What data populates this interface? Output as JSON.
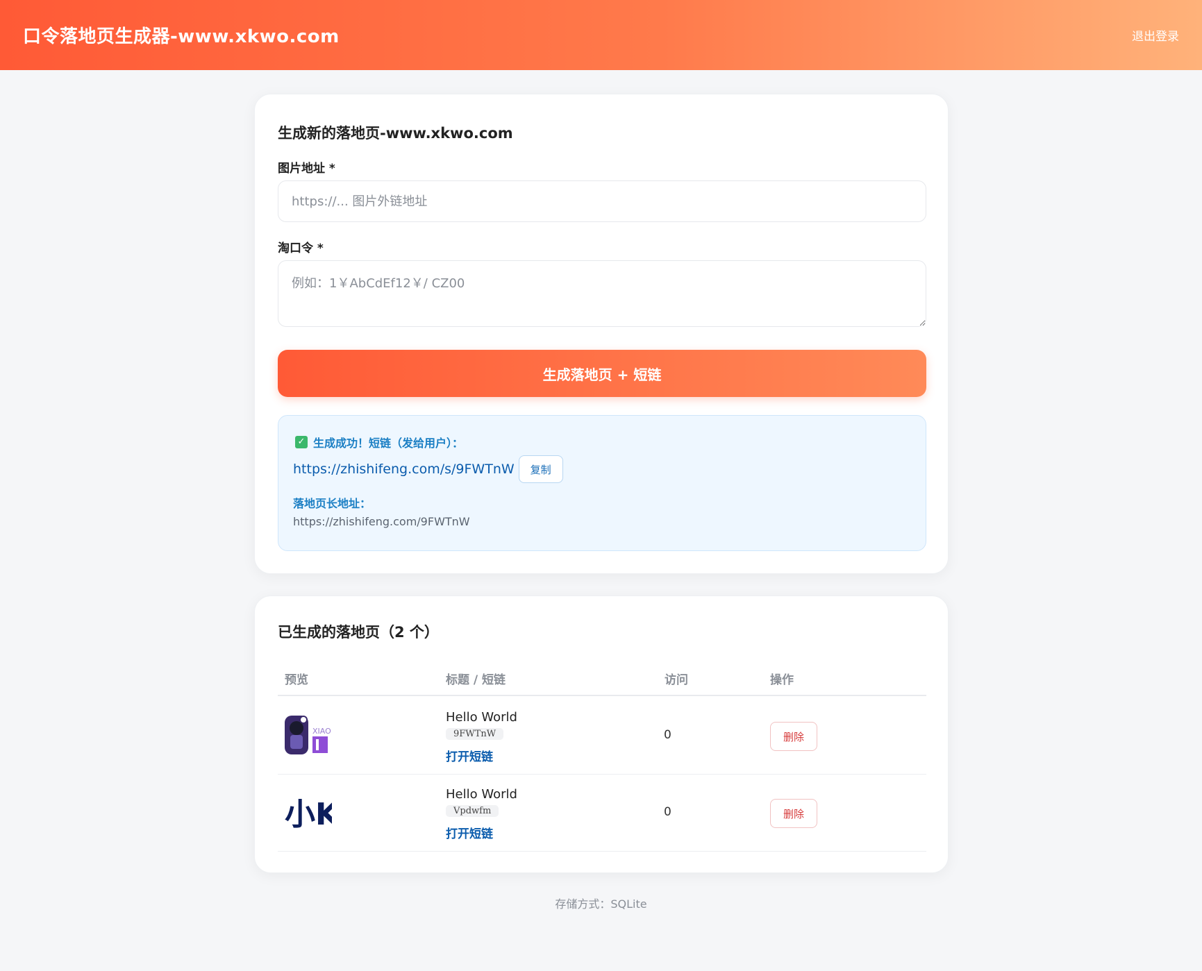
{
  "header": {
    "title": "口令落地页生成器-www.xkwo.com",
    "logout_label": "退出登录"
  },
  "generate_card": {
    "title": "生成新的落地页-www.xkwo.com",
    "image_label": "图片地址 *",
    "image_placeholder": "https://... 图片外链地址",
    "image_value": "",
    "code_label": "淘口令 *",
    "code_placeholder": "例如：1￥AbCdEf12￥/ CZ00",
    "code_value": "",
    "submit_label": "生成落地页 + 短链"
  },
  "result": {
    "check_icon": "✓",
    "success_text": "生成成功！短链（发给用户）：",
    "short_url": "https://zhishifeng.com/s/9FWTnW",
    "copy_label": "复制",
    "long_label": "落地页长地址：",
    "long_url": "https://zhishifeng.com/9FWTnW"
  },
  "list_card": {
    "title": "已生成的落地页（2 个）",
    "columns": [
      "预览",
      "标题 / 短链",
      "访问",
      "操作"
    ],
    "rows": [
      {
        "title": "Hello World",
        "code": "9FWTnW",
        "open_label": "打开短链",
        "visits": "0",
        "delete_label": "删除",
        "thumb_text": "XIAO"
      },
      {
        "title": "Hello World",
        "code": "Vpdwfm",
        "open_label": "打开短链",
        "visits": "0",
        "delete_label": "删除",
        "thumb_text": "小K"
      }
    ]
  },
  "footer": {
    "storage_text": "存储方式：SQLite"
  },
  "colors": {
    "accent": "#ff5a36",
    "accent_light": "#ffb27a",
    "link": "#0b5cad",
    "success_bg": "#eef7ff",
    "danger": "#d63b3b"
  }
}
